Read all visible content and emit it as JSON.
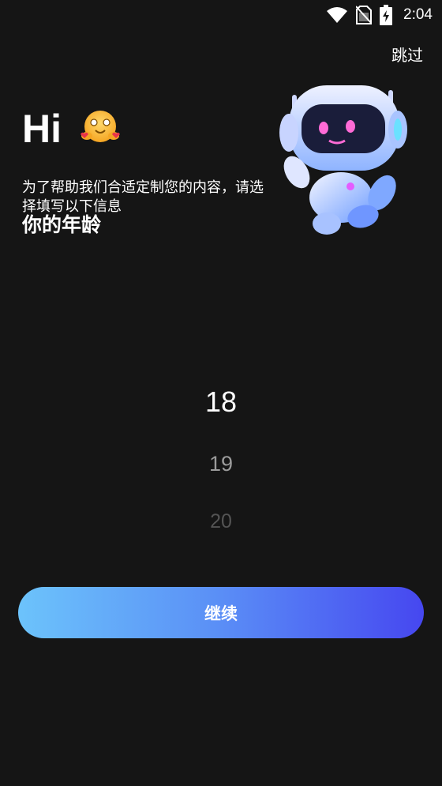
{
  "status_bar": {
    "time": "2:04"
  },
  "header": {
    "skip_label": "跳过"
  },
  "greeting": {
    "hi": "Hi",
    "subtitle": "为了帮助我们合适定制您的内容，请选择填写以下信息",
    "age_title": "你的年龄"
  },
  "age_picker": {
    "selected": "18",
    "options": [
      "18",
      "19",
      "20"
    ]
  },
  "footer": {
    "continue_label": "继续"
  },
  "colors": {
    "background": "#151515",
    "button_gradient_start": "#6cc3fb",
    "button_gradient_end": "#4647f0"
  },
  "icons": [
    "wifi-icon",
    "no-sim-icon",
    "battery-charging-icon",
    "hug-emoji-icon",
    "robot-mascot"
  ]
}
